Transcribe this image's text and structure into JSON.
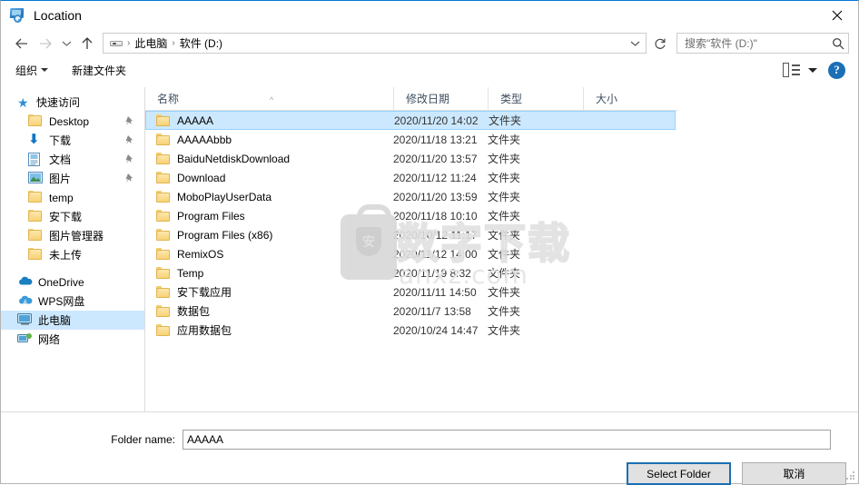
{
  "window": {
    "title": "Location",
    "title_icon": "computer-location-icon",
    "close_icon": "close-icon"
  },
  "address_bar": {
    "back_icon": "back-arrow-icon",
    "forward_icon": "forward-arrow-icon",
    "recent_icon": "chevron-down-icon",
    "up_icon": "up-arrow-icon",
    "drive_icon": "drive-icon",
    "crumbs": [
      "此电脑",
      "软件 (D:)"
    ],
    "separator": "›",
    "dropdown_icon": "chevron-down-icon",
    "refresh_icon": "refresh-icon",
    "search_placeholder": "搜索\"软件 (D:)\"",
    "search_icon": "search-icon"
  },
  "toolbar": {
    "organize_label": "组织",
    "organize_caret_icon": "caret-down-icon",
    "new_folder_label": "新建文件夹",
    "view_icon": "view-mode-icon",
    "view_caret_icon": "caret-down-icon",
    "help_label": "?",
    "help_icon": "help-icon"
  },
  "sidebar": {
    "groups": [
      {
        "header": {
          "label": "快速访问",
          "icon": "star-pin-icon"
        },
        "items": [
          {
            "label": "Desktop",
            "icon": "folder-icon",
            "pinned": true,
            "selected": false
          },
          {
            "label": "下载",
            "icon": "download-arrow-icon",
            "pinned": true,
            "selected": false
          },
          {
            "label": "文档",
            "icon": "documents-icon",
            "pinned": true,
            "selected": false
          },
          {
            "label": "图片",
            "icon": "pictures-icon",
            "pinned": true,
            "selected": false
          },
          {
            "label": "temp",
            "icon": "folder-icon",
            "pinned": false,
            "selected": false
          },
          {
            "label": "安下载",
            "icon": "folder-icon",
            "pinned": false,
            "selected": false
          },
          {
            "label": "图片管理器",
            "icon": "folder-icon",
            "pinned": false,
            "selected": false
          },
          {
            "label": "未上传",
            "icon": "folder-icon",
            "pinned": false,
            "selected": false
          }
        ]
      },
      {
        "items": [
          {
            "label": "OneDrive",
            "icon": "onedrive-cloud-icon",
            "pinned": false,
            "selected": false
          },
          {
            "label": "WPS网盘",
            "icon": "wps-cloud-icon",
            "pinned": false,
            "selected": false
          },
          {
            "label": "此电脑",
            "icon": "this-pc-icon",
            "pinned": false,
            "selected": true
          },
          {
            "label": "网络",
            "icon": "network-icon",
            "pinned": false,
            "selected": false
          }
        ]
      }
    ]
  },
  "file_list": {
    "columns": [
      "名称",
      "修改日期",
      "类型",
      "大小"
    ],
    "sort_indicator": "^",
    "rows": [
      {
        "name": "AAAAA",
        "date": "2020/11/20 14:02",
        "type": "文件夹",
        "size": "",
        "selected": true
      },
      {
        "name": "AAAAAbbb",
        "date": "2020/11/18 13:21",
        "type": "文件夹",
        "size": "",
        "selected": false
      },
      {
        "name": "BaiduNetdiskDownload",
        "date": "2020/11/20 13:57",
        "type": "文件夹",
        "size": "",
        "selected": false
      },
      {
        "name": "Download",
        "date": "2020/11/12 11:24",
        "type": "文件夹",
        "size": "",
        "selected": false
      },
      {
        "name": "MoboPlayUserData",
        "date": "2020/11/20 13:59",
        "type": "文件夹",
        "size": "",
        "selected": false
      },
      {
        "name": "Program Files",
        "date": "2020/11/18 10:10",
        "type": "文件夹",
        "size": "",
        "selected": false
      },
      {
        "name": "Program Files (x86)",
        "date": "2020/10/12 11:17",
        "type": "文件夹",
        "size": "",
        "selected": false
      },
      {
        "name": "RemixOS",
        "date": "2020/11/12 14:00",
        "type": "文件夹",
        "size": "",
        "selected": false
      },
      {
        "name": "Temp",
        "date": "2020/11/19 8:32",
        "type": "文件夹",
        "size": "",
        "selected": false
      },
      {
        "name": "安下载应用",
        "date": "2020/11/11 14:50",
        "type": "文件夹",
        "size": "",
        "selected": false
      },
      {
        "name": "数据包",
        "date": "2020/11/7 13:58",
        "type": "文件夹",
        "size": "",
        "selected": false
      },
      {
        "name": "应用数据包",
        "date": "2020/10/24 14:47",
        "type": "文件夹",
        "size": "",
        "selected": false
      }
    ]
  },
  "watermark": {
    "badge_char": "安",
    "main_text": "数字下载",
    "sub_text": "anxz.com"
  },
  "footer": {
    "folder_name_label": "Folder name:",
    "folder_name_value": "AAAAA",
    "select_button": "Select Folder",
    "cancel_button": "取消"
  },
  "colors": {
    "selection": "#cce8ff",
    "accent": "#0078d7",
    "folder": "#f8d276",
    "default_button_border": "#1b6fb3"
  }
}
